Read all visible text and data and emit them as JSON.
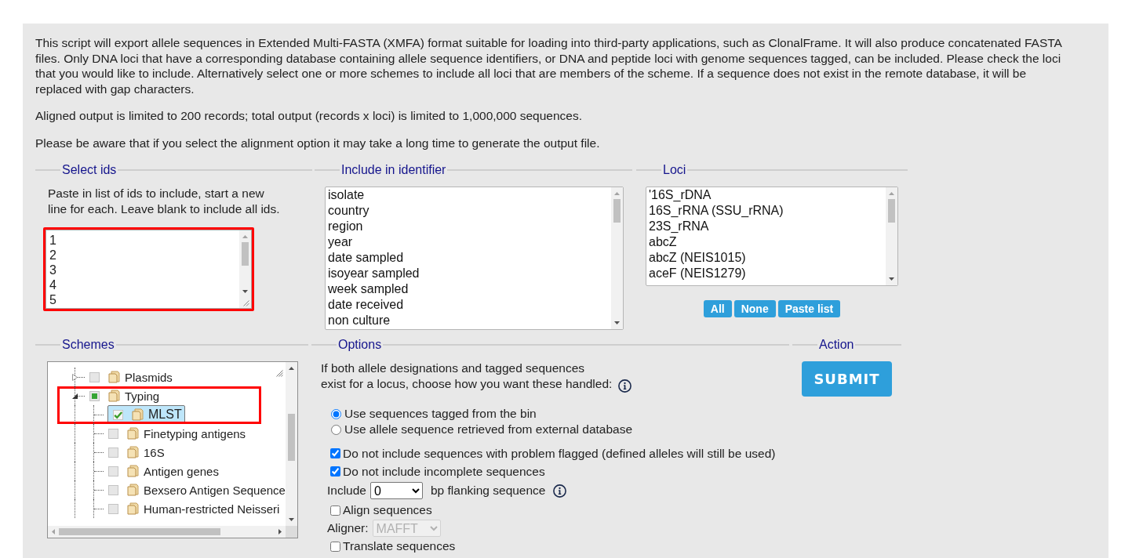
{
  "intro": {
    "paragraphs": [
      "This script will export allele sequences in Extended Multi-FASTA (XMFA) format suitable for loading into third-party applications, such as ClonalFrame. It will also produce concatenated FASTA files. Only DNA loci that have a corresponding database containing allele sequence identifiers, or DNA and peptide loci with genome sequences tagged, can be included. Please check the loci that you would like to include. Alternatively select one or more schemes to include all loci that are members of the scheme. If a sequence does not exist in the remote database, it will be replaced with gap characters.",
      "Aligned output is limited to 200 records; total output (records x loci) is limited to 1,000,000 sequences.",
      "Please be aware that if you select the alignment option it may take a long time to generate the output file."
    ]
  },
  "select_ids": {
    "legend": "Select ids",
    "help": "Paste in list of ids to include, start a new line for each. Leave blank to include all ids.",
    "field": {
      "value": "1\n2\n3\n4\n5",
      "highlighted": true
    }
  },
  "include_in_identifier": {
    "legend": "Include in identifier",
    "options": [
      {
        "label": "isolate",
        "selected": false
      },
      {
        "label": "country",
        "selected": false
      },
      {
        "label": "region",
        "selected": false
      },
      {
        "label": "year",
        "selected": false
      },
      {
        "label": "date sampled",
        "selected": false
      },
      {
        "label": "isoyear sampled",
        "selected": false
      },
      {
        "label": "week sampled",
        "selected": false
      },
      {
        "label": "date received",
        "selected": false
      },
      {
        "label": "non culture",
        "selected": false
      }
    ]
  },
  "loci": {
    "legend": "Loci",
    "options": [
      {
        "label": "'16S_rDNA",
        "selected": false
      },
      {
        "label": "16S_rRNA (SSU_rRNA)",
        "selected": false
      },
      {
        "label": "23S_rRNA",
        "selected": false
      },
      {
        "label": "abcZ",
        "selected": false
      },
      {
        "label": "abcZ (NEIS1015)",
        "selected": false
      },
      {
        "label": "aceF (NEIS1279)",
        "selected": false
      }
    ],
    "buttons": [
      "All",
      "None",
      "Paste list"
    ]
  },
  "schemes": {
    "legend": "Schemes",
    "tree": [
      {
        "label": "Plasmids",
        "expanded": false,
        "checked": false,
        "partial": false,
        "selected": false,
        "highlighted": false
      },
      {
        "label": "Typing",
        "expanded": true,
        "checked": false,
        "partial": true,
        "selected": false,
        "highlighted": true,
        "children": [
          {
            "label": "MLST",
            "checked": true,
            "partial": false,
            "selected": true,
            "highlighted": true
          },
          {
            "label": "Finetyping antigens",
            "checked": false,
            "partial": false,
            "selected": false,
            "highlighted": false
          },
          {
            "label": "16S",
            "checked": false,
            "partial": false,
            "selected": false,
            "highlighted": false
          },
          {
            "label": "Antigen genes",
            "checked": false,
            "partial": false,
            "selected": false,
            "highlighted": false
          },
          {
            "label": "Bexsero Antigen Sequence",
            "checked": false,
            "partial": false,
            "selected": false,
            "highlighted": false
          },
          {
            "label": "Human-restricted Neisseri",
            "checked": false,
            "partial": false,
            "selected": false,
            "highlighted": false
          }
        ]
      }
    ]
  },
  "options": {
    "legend": "Options",
    "prompt": "If both allele designations and tagged sequences\nexist for a locus, choose how you want these handled:",
    "radios": [
      {
        "label": "Use sequences tagged from the bin",
        "selected": true
      },
      {
        "label": "Use allele sequence retrieved from external database",
        "selected": false
      }
    ],
    "checkboxes": [
      {
        "label": "Do not include sequences with problem flagged (defined alleles will still be used)",
        "checked": true
      },
      {
        "label": "Do not include incomplete sequences",
        "checked": true
      }
    ],
    "flanking": {
      "label": "Include",
      "value": "0",
      "suffix": "bp flanking sequence"
    },
    "align": {
      "label": "Align sequences",
      "checked": false
    },
    "aligner": {
      "label": "Aligner:",
      "value": "MAFFT",
      "disabled": true
    },
    "translate": {
      "label": "Translate sequences",
      "checked": false
    }
  },
  "action": {
    "legend": "Action",
    "button": "SUBMIT"
  }
}
